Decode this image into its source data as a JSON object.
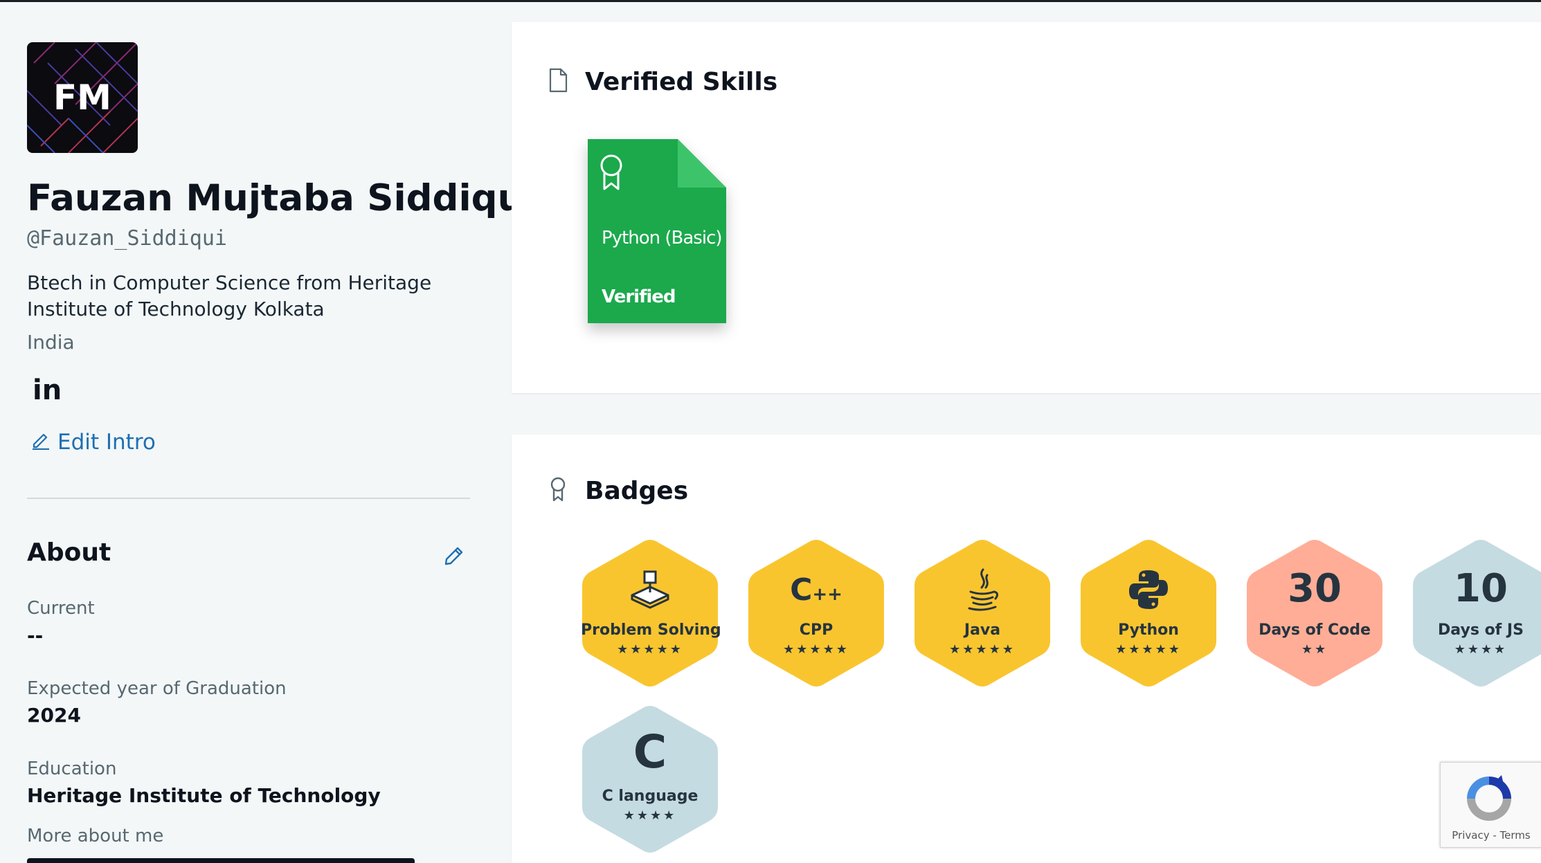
{
  "profile": {
    "initials": "FM",
    "name": "Fauzan Mujtaba Siddiqui",
    "handle": "@Fauzan_Siddiqui",
    "bio": "Btech in Computer Science from Heritage Institute of Technology Kolkata",
    "country": "India",
    "linkedin_label": "in",
    "edit_intro_label": "Edit Intro"
  },
  "about": {
    "title": "About",
    "fields": [
      {
        "label": "Current",
        "value": "--"
      },
      {
        "label": "Expected year of Graduation",
        "value": "2024"
      },
      {
        "label": "Education",
        "value": "Heritage Institute of Technology"
      }
    ],
    "more_label": "More about me"
  },
  "skills": {
    "title": "Verified Skills",
    "items": [
      {
        "name": "Python (Basic)",
        "status": "Verified",
        "color": "#1ba94c"
      }
    ]
  },
  "badges": {
    "title": "Badges",
    "items": [
      {
        "label": "Problem Solving",
        "icon": "problem-solving-icon",
        "stars": "★★★★★",
        "stars_count": 5,
        "color": "#f9c52f"
      },
      {
        "label": "CPP",
        "icon": "cpp-icon",
        "stars": "★★★★★",
        "stars_count": 5,
        "color": "#f9c52f"
      },
      {
        "label": "Java",
        "icon": "java-icon",
        "stars": "★★★★★",
        "stars_count": 5,
        "color": "#f9c52f"
      },
      {
        "label": "Python",
        "icon": "python-icon",
        "stars": "★★★★★",
        "stars_count": 5,
        "color": "#f9c52f"
      },
      {
        "number": "30",
        "label": "Days of Code",
        "stars": "★★",
        "stars_count": 2,
        "color": "#ffad96"
      },
      {
        "number": "10",
        "label": "Days of JS",
        "stars": "★★★★",
        "stars_count": 4,
        "color": "#c4dbe1"
      },
      {
        "icon_text": "C",
        "label": "C language",
        "stars": "★★★★",
        "stars_count": 4,
        "color": "#c4dbe1"
      }
    ]
  },
  "recaptcha": {
    "privacy": "Privacy",
    "separator": " - ",
    "terms": "Terms"
  },
  "colors": {
    "accent_link": "#1e6fb3",
    "gold_badge": "#f9c52f",
    "orange_badge": "#ffad96",
    "blue_badge": "#c4dbe1",
    "skill_green": "#1ba94c"
  }
}
